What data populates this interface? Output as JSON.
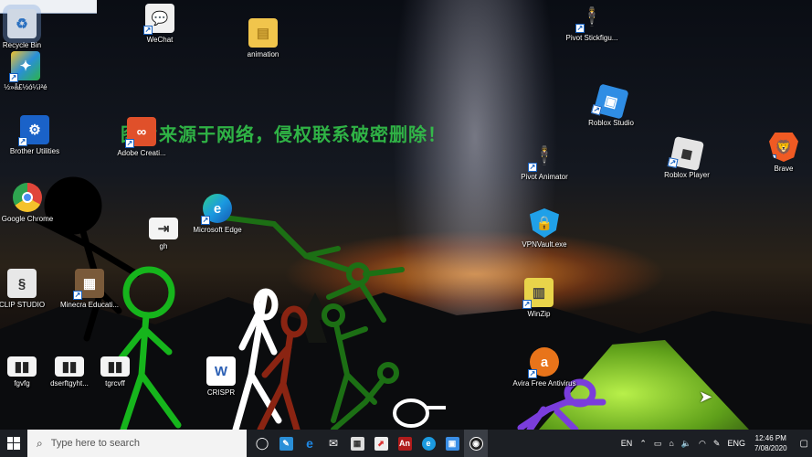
{
  "watermark": "图片来源于网络，侵权联系破密删除！",
  "desktop_icons": [
    {
      "label": "Recycle Bin",
      "icon": "recycle-bin-icon",
      "color": "#cfd8e4"
    },
    {
      "label": "½»å£½ó¼ì²é",
      "icon": "app-icon",
      "color": "#2a8fd8"
    },
    {
      "label": "Brother Utilities",
      "icon": "brother-utilities-icon",
      "color": "#1a62c8"
    },
    {
      "label": "Google Chrome",
      "icon": "chrome-icon",
      "color": "#e0463a"
    },
    {
      "label": "CLIP STUDIO",
      "icon": "clip-studio-icon",
      "color": "#e8e8e8"
    },
    {
      "label": "fgvfg",
      "icon": "video-file-icon",
      "color": "#f4f4f4"
    },
    {
      "label": "dserftgyht...",
      "icon": "video-file-icon",
      "color": "#f4f4f4"
    },
    {
      "label": "tgrcvff",
      "icon": "video-file-icon",
      "color": "#f4f4f4"
    },
    {
      "label": "WeChat",
      "icon": "wechat-icon",
      "color": "#2dbb3a"
    },
    {
      "label": "Adobe Creati...",
      "icon": "adobe-cc-icon",
      "color": "#e0502a"
    },
    {
      "label": "Minecra Educati...",
      "icon": "minecraft-icon",
      "color": "#7a5a3a"
    },
    {
      "label": "gh",
      "icon": "file-icon",
      "color": "#f4f4f4"
    },
    {
      "label": "Microsoft Edge",
      "icon": "edge-icon",
      "color": "#1b9ae0"
    },
    {
      "label": "CRISPR",
      "icon": "word-doc-icon",
      "color": "#2b5fb4"
    },
    {
      "label": "animation",
      "icon": "folder-icon",
      "color": "#f1c54c"
    },
    {
      "label": "Pivot Stickfigu...",
      "icon": "pivot-icon",
      "color": "#b3271b"
    },
    {
      "label": "Roblox Studio",
      "icon": "roblox-studio-icon",
      "color": "#2f8de4"
    },
    {
      "label": "Pivot Animator",
      "icon": "pivot-icon",
      "color": "#b3271b"
    },
    {
      "label": "VPNVault.exe",
      "icon": "vpn-shield-icon",
      "color": "#20a0e8"
    },
    {
      "label": "WinZip",
      "icon": "winzip-icon",
      "color": "#e8d44a"
    },
    {
      "label": "Avira Free Antivirus",
      "icon": "avira-icon",
      "color": "#e8741a"
    },
    {
      "label": "Roblox Player",
      "icon": "roblox-icon",
      "color": "#e4e4e4"
    },
    {
      "label": "Brave",
      "icon": "brave-icon",
      "color": "#f05a23"
    }
  ],
  "taskbar": {
    "search_placeholder": "Type here to search",
    "apps": [
      {
        "name": "task-view",
        "glyph": "◯",
        "color": "transparent"
      },
      {
        "name": "windows-ink",
        "glyph": "✎",
        "color": "#2a8fd8"
      },
      {
        "name": "internet-explorer",
        "glyph": "e",
        "color": "#1e88e5"
      },
      {
        "name": "mail",
        "glyph": "✉",
        "color": "#d0d0d0"
      },
      {
        "name": "pivot",
        "glyph": "▦",
        "color": "#333"
      },
      {
        "name": "shared-app",
        "glyph": "⬈",
        "color": "#d33"
      },
      {
        "name": "animate",
        "glyph": "An",
        "color": "#b01c1c"
      },
      {
        "name": "edge",
        "glyph": "e",
        "color": "#1b9ae0"
      },
      {
        "name": "store",
        "glyph": "▣",
        "color": "#3a8ee6"
      },
      {
        "name": "obs",
        "glyph": "◉",
        "color": "#3a3a3a"
      }
    ],
    "tray": {
      "lang_short": "EN",
      "lang": "ENG",
      "time": "12:46 PM",
      "date": "7/08/2020"
    }
  }
}
